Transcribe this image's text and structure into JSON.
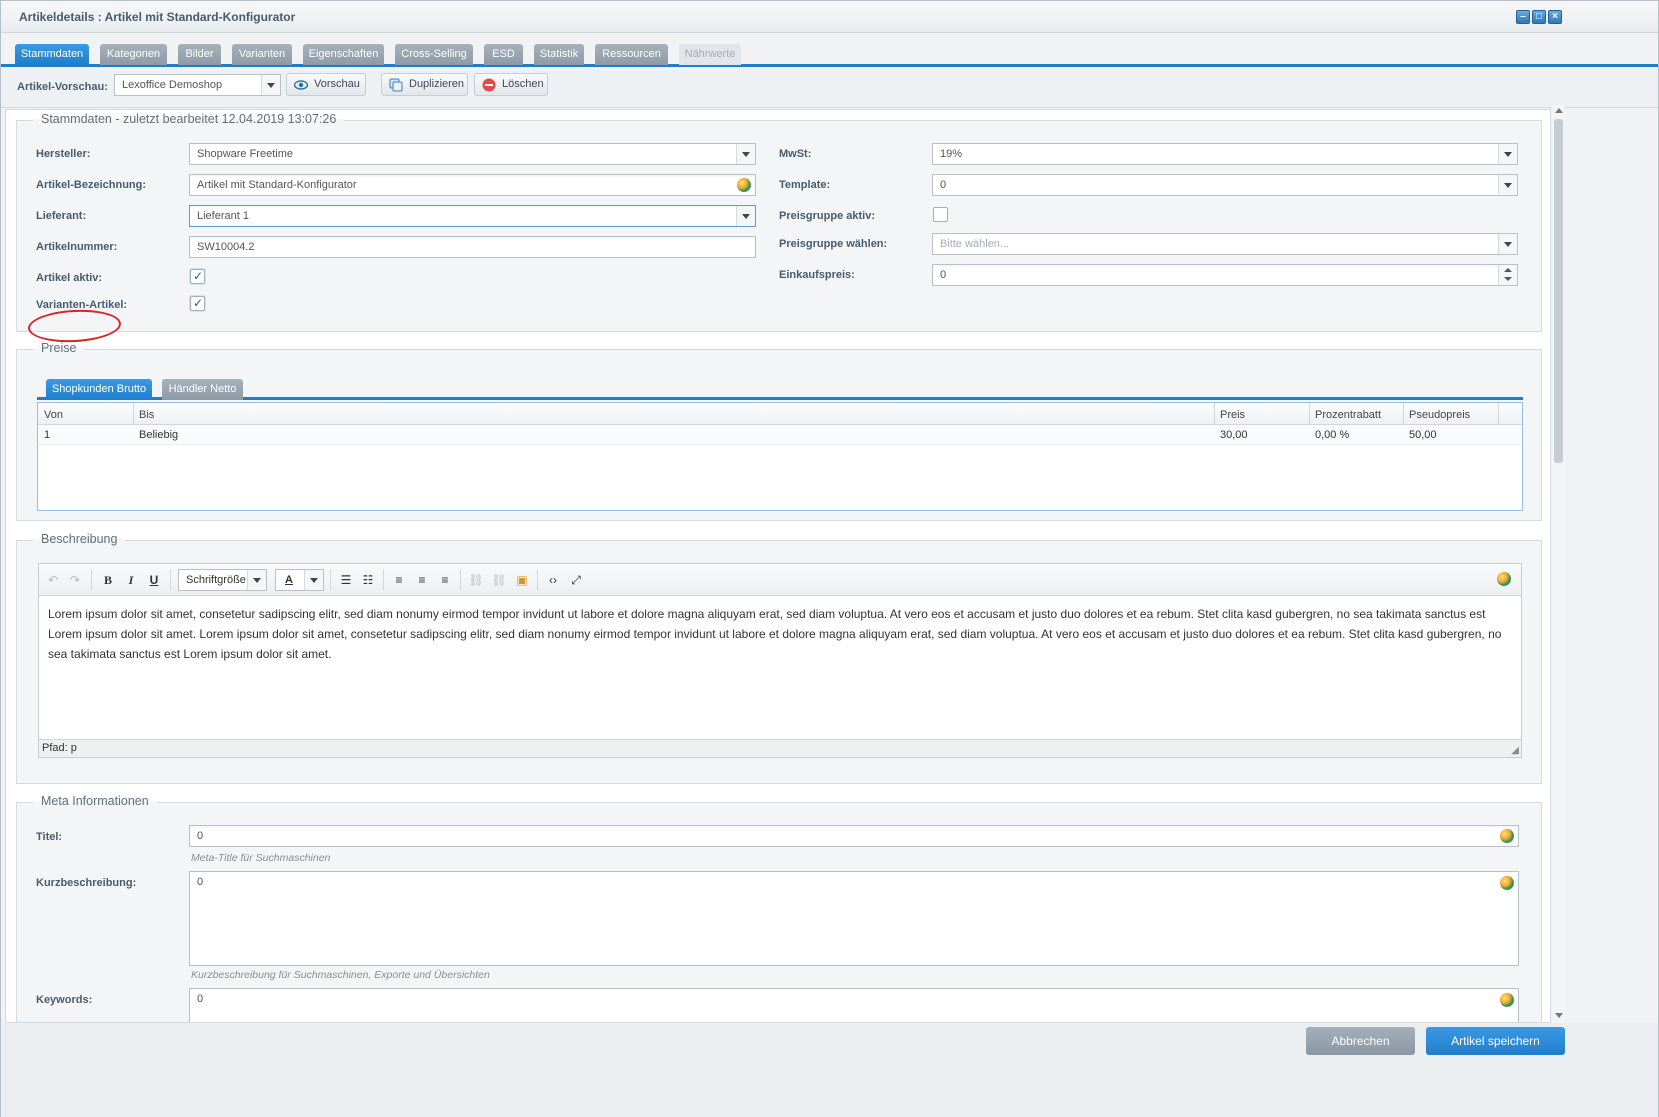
{
  "window": {
    "title": "Artikeldetails : Artikel mit Standard-Konfigurator"
  },
  "tabs": [
    {
      "label": "Stammdaten",
      "state": "active"
    },
    {
      "label": "Kategorien",
      "state": "normal"
    },
    {
      "label": "Bilder",
      "state": "normal"
    },
    {
      "label": "Varianten",
      "state": "normal"
    },
    {
      "label": "Eigenschaften",
      "state": "normal"
    },
    {
      "label": "Cross-Selling",
      "state": "normal"
    },
    {
      "label": "ESD",
      "state": "normal"
    },
    {
      "label": "Statistik",
      "state": "normal"
    },
    {
      "label": "Ressourcen",
      "state": "normal"
    },
    {
      "label": "Nährwerte",
      "state": "disabled"
    }
  ],
  "toolbar": {
    "preview_label": "Artikel-Vorschau:",
    "shop_value": "Lexoffice Demoshop",
    "preview_button": "Vorschau",
    "duplicate_button": "Duplizieren",
    "delete_button": "Löschen"
  },
  "stammdaten": {
    "legend": "Stammdaten - zuletzt bearbeitet 12.04.2019 13:07:26",
    "hersteller_label": "Hersteller:",
    "hersteller_value": "Shopware Freetime",
    "bezeichnung_label": "Artikel-Bezeichnung:",
    "bezeichnung_value": "Artikel mit Standard-Konfigurator",
    "lieferant_label": "Lieferant:",
    "lieferant_value": "Lieferant 1",
    "artikelnummer_label": "Artikelnummer:",
    "artikelnummer_value": "SW10004.2",
    "aktiv_label": "Artikel aktiv:",
    "aktiv_checked": true,
    "varianten_label": "Varianten-Artikel:",
    "varianten_checked": true,
    "mwst_label": "MwSt:",
    "mwst_value": "19%",
    "template_label": "Template:",
    "template_value": "0",
    "preisgruppe_aktiv_label": "Preisgruppe aktiv:",
    "preisgruppe_aktiv_checked": false,
    "preisgruppe_waehlen_label": "Preisgruppe wählen:",
    "preisgruppe_waehlen_placeholder": "Bitte wählen...",
    "einkaufspreis_label": "Einkaufspreis:",
    "einkaufspreis_value": "0"
  },
  "preise": {
    "legend": "Preise",
    "tabs": [
      "Shopkunden Brutto",
      "Händler Netto"
    ],
    "columns": [
      "Von",
      "Bis",
      "Preis",
      "Prozentrabatt",
      "Pseudopreis"
    ],
    "rows": [
      {
        "von": "1",
        "bis": "Beliebig",
        "preis": "30,00",
        "prozentrabatt": "0,00 %",
        "pseudopreis": "50,00"
      }
    ]
  },
  "beschreibung": {
    "legend": "Beschreibung",
    "fontsize_label": "Schriftgröße",
    "font_color_glyph": "A",
    "text": "Lorem ipsum dolor sit amet, consetetur sadipscing elitr, sed diam nonumy eirmod tempor invidunt ut labore et dolore magna aliquyam erat, sed diam voluptua. At vero eos et accusam et justo duo dolores et ea rebum. Stet clita kasd gubergren, no sea takimata sanctus est Lorem ipsum dolor sit amet. Lorem ipsum dolor sit amet, consetetur sadipscing elitr, sed diam nonumy eirmod tempor invidunt ut labore et dolore magna aliquyam erat, sed diam voluptua. At vero eos et accusam et justo duo dolores et ea rebum. Stet clita kasd gubergren, no sea takimata sanctus est Lorem ipsum dolor sit amet.",
    "path_label": "Pfad: p"
  },
  "meta": {
    "legend": "Meta Informationen",
    "titel_label": "Titel:",
    "titel_value": "0",
    "titel_hint": "Meta-Title für Suchmaschinen",
    "kurz_label": "Kurzbeschreibung:",
    "kurz_value": "0",
    "kurz_hint": "Kurzbeschreibung für Suchmaschinen, Exporte und Übersichten",
    "keywords_label": "Keywords:",
    "keywords_value": "0"
  },
  "footer": {
    "cancel_button": "Abbrechen",
    "save_button": "Artikel speichern"
  },
  "colors": {
    "accent": "#1f7ecb",
    "annotation": "#d8252b"
  }
}
